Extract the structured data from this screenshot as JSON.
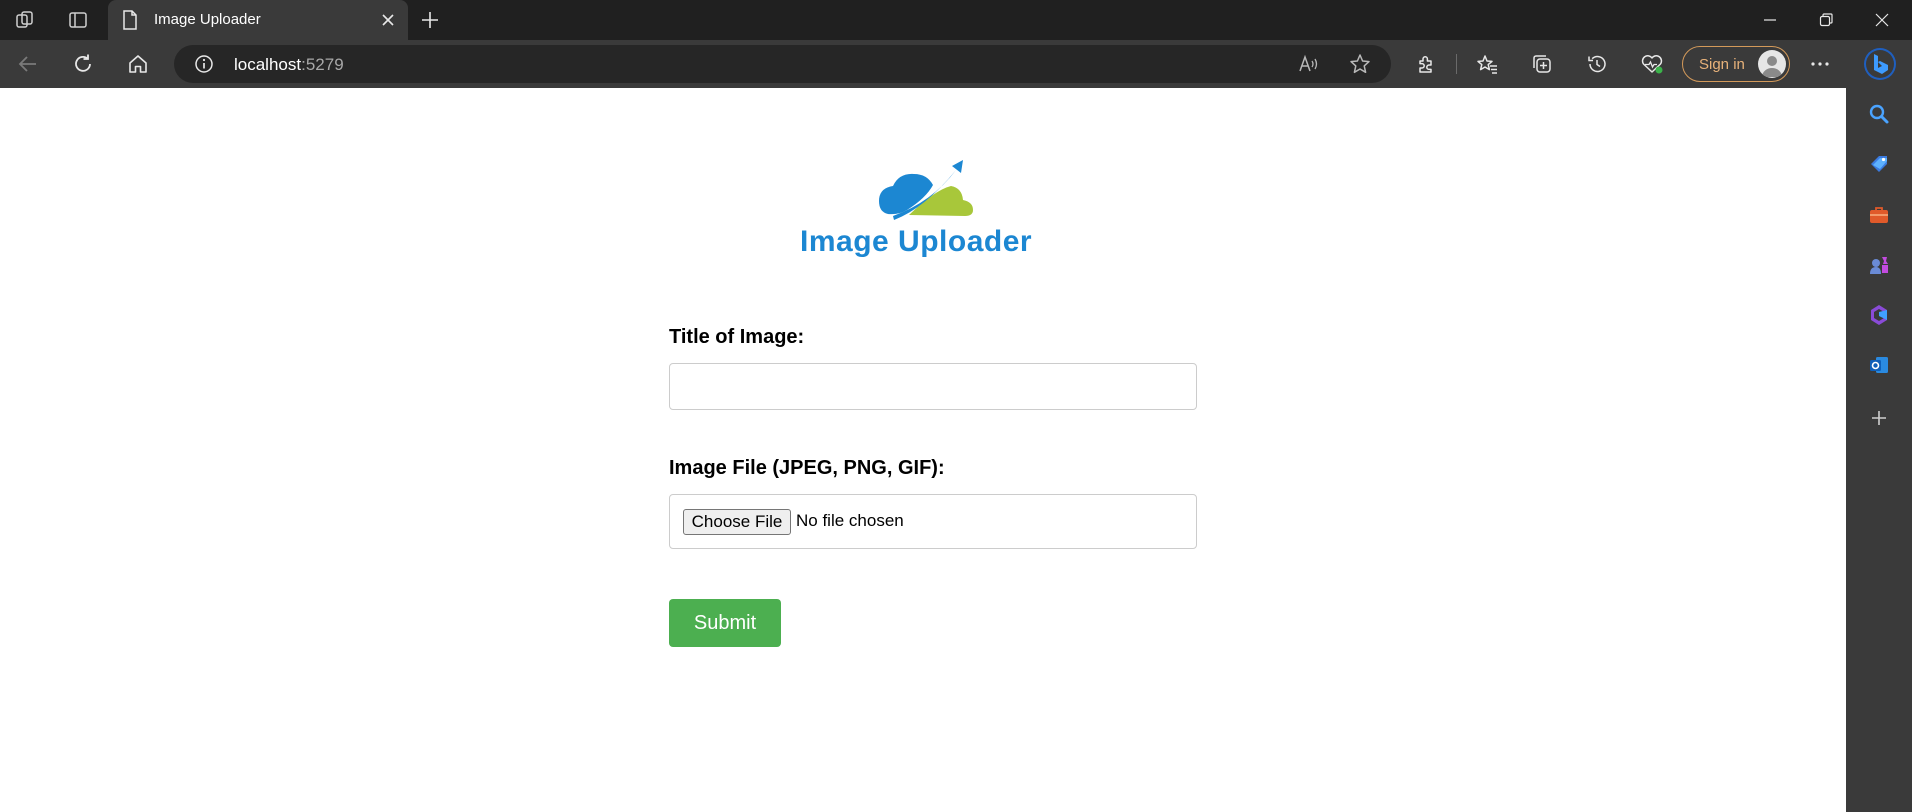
{
  "browser": {
    "tab_title": "Image Uploader",
    "url_host": "localhost",
    "url_port": ":5279",
    "signin_label": "Sign in"
  },
  "page": {
    "logo_text": "Image Uploader",
    "title_label": "Title of Image:",
    "title_value": "",
    "file_label": "Image File (JPEG, PNG, GIF):",
    "choose_file_label": "Choose File",
    "file_status": "No file chosen",
    "submit_label": "Submit"
  },
  "colors": {
    "submit": "#4caf50",
    "logo_blue": "#1c87d2",
    "logo_green": "#a8c73a",
    "signin_accent": "#e8b27a"
  },
  "icons": {
    "titlebar": [
      "workspaces-icon",
      "tab-actions-icon",
      "page-icon",
      "close-icon",
      "plus-icon",
      "minimize-icon",
      "restore-icon",
      "close-window-icon"
    ],
    "toolbar": [
      "back-arrow-icon",
      "refresh-icon",
      "home-icon",
      "info-icon",
      "read-aloud-icon",
      "star-icon",
      "extensions-icon",
      "favorites-icon",
      "collections-icon",
      "history-icon",
      "browser-essentials-icon",
      "more-icon",
      "copilot-icon"
    ],
    "sidebar": [
      "search-icon",
      "shopping-tag-icon",
      "tools-briefcase-icon",
      "games-icon",
      "office-icon",
      "outlook-icon",
      "plus-icon"
    ]
  }
}
